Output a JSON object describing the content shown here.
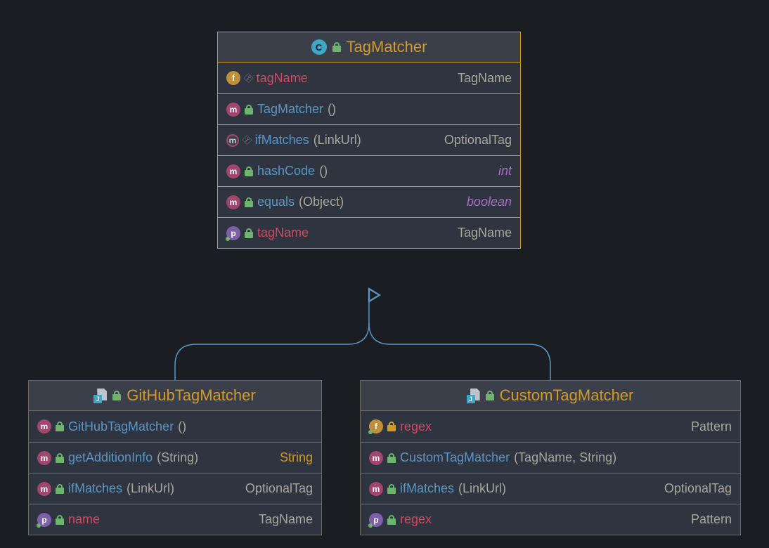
{
  "colors": {
    "background": "#1a1d21",
    "box_bg": "#2e3440",
    "header_bg": "#3b3f49",
    "accent_gold": "#d19a2a",
    "border_neutral": "#6b6a5e",
    "name_red": "#d04a5f",
    "name_blue": "#5b96c4",
    "type_gold": "#aaa79a",
    "type_purple": "#a86fbf",
    "connection": "#5b96c4"
  },
  "parent": {
    "title": "TagMatcher",
    "rows": [
      {
        "kind": "f",
        "access": "key",
        "name": "tagName",
        "nameColor": "red",
        "params": null,
        "type": "TagName",
        "typeColor": "gold"
      },
      {
        "kind": "m",
        "access": "open",
        "name": "TagMatcher",
        "nameColor": "blue",
        "params": "",
        "type": null
      },
      {
        "kind": "m-hollow",
        "access": "key",
        "name": "ifMatches",
        "nameColor": "blue",
        "params": "LinkUrl",
        "type": "OptionalTag",
        "typeColor": "gold"
      },
      {
        "kind": "m",
        "access": "open",
        "name": "hashCode",
        "nameColor": "blue",
        "params": "",
        "type": "int",
        "typeColor": "purple"
      },
      {
        "kind": "m",
        "access": "open",
        "name": "equals",
        "nameColor": "blue",
        "params": "Object",
        "type": "boolean",
        "typeColor": "purple"
      },
      {
        "kind": "p",
        "access": "open",
        "name": "tagName",
        "nameColor": "red",
        "params": null,
        "type": "TagName",
        "typeColor": "gold"
      }
    ]
  },
  "children": [
    {
      "title": "GitHubTagMatcher",
      "rows": [
        {
          "kind": "m",
          "access": "open",
          "name": "GitHubTagMatcher",
          "nameColor": "blue",
          "params": "",
          "type": null
        },
        {
          "kind": "m",
          "access": "open",
          "name": "getAdditionInfo",
          "nameColor": "blue",
          "params": "String",
          "type": "String",
          "typeColor": "orange"
        },
        {
          "kind": "m",
          "access": "open",
          "name": "ifMatches",
          "nameColor": "blue",
          "params": "LinkUrl",
          "type": "OptionalTag",
          "typeColor": "gold"
        },
        {
          "kind": "p",
          "access": "open",
          "name": "name",
          "nameColor": "red",
          "params": null,
          "type": "TagName",
          "typeColor": "gold"
        }
      ]
    },
    {
      "title": "CustomTagMatcher",
      "rows": [
        {
          "kind": "f-dot",
          "access": "closed",
          "name": "regex",
          "nameColor": "red",
          "params": null,
          "type": "Pattern",
          "typeColor": "gold"
        },
        {
          "kind": "m",
          "access": "open",
          "name": "CustomTagMatcher",
          "nameColor": "blue",
          "params": "TagName, String",
          "type": null
        },
        {
          "kind": "m",
          "access": "open",
          "name": "ifMatches",
          "nameColor": "blue",
          "params": "LinkUrl",
          "type": "OptionalTag",
          "typeColor": "gold"
        },
        {
          "kind": "p",
          "access": "open",
          "name": "regex",
          "nameColor": "red",
          "params": null,
          "type": "Pattern",
          "typeColor": "gold"
        }
      ]
    }
  ]
}
